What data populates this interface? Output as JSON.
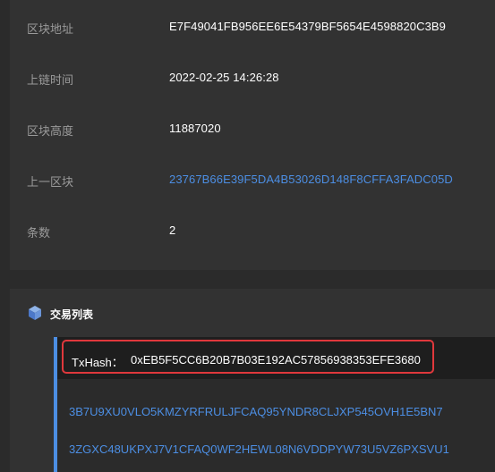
{
  "block_info": {
    "rows": [
      {
        "label": "区块地址",
        "value": "E7F49041FB956EE6E54379BF5654E4598820C3B9"
      },
      {
        "label": "上链时间",
        "value": "2022-02-25 14:26:28"
      },
      {
        "label": "区块高度",
        "value": "11887020"
      },
      {
        "label": "上一区块",
        "value": "23767B66E39F5DA4B53026D148F8CFFA3FADC05D"
      },
      {
        "label": "条数",
        "value": "2"
      }
    ]
  },
  "tx_section": {
    "title": "交易列表",
    "icon": "cube-icon",
    "tx_hash_label": "TxHash：",
    "tx_hash_value": "0xEB5F5CC6B20B7B03E192AC57856938353EFE3680",
    "items": [
      "3B7U9XU0VLO5KMZYRFRULJFCAQ95YNDR8CLJXP545OVH1E5BN7",
      "3ZGXC48UKPXJ7V1CFAQ0WF2HEWL08N6VDDPYW73U5VZ6PXSVU1"
    ]
  },
  "colors": {
    "background": "#2b2b2b",
    "panel": "#323232",
    "label": "#9a9a9a",
    "link": "#4c8ee3",
    "highlight_border": "#e0383c"
  }
}
